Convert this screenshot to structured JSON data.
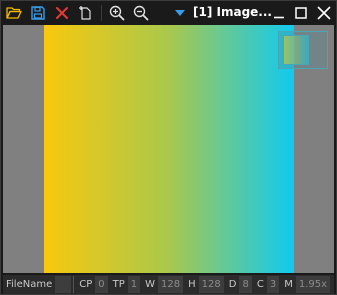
{
  "window": {
    "title": "[1] Image..."
  },
  "toolbar": {
    "open_icon": "folder-open-icon",
    "save_icon": "floppy-disk-icon",
    "close_image_icon": "red-x-icon",
    "new_icon": "new-document-plus-icon",
    "zoom_in_icon": "zoom-in-icon",
    "zoom_out_icon": "zoom-out-icon",
    "dropdown_icon": "triangle-down-icon",
    "minimize_icon": "minimize-icon",
    "maximize_icon": "maximize-icon",
    "close_icon": "close-icon"
  },
  "image": {
    "gradient_start": "#f9c80e",
    "gradient_mid": "#a9c84c",
    "gradient_end": "#0fcaf0",
    "background": "#808080"
  },
  "statusbar": {
    "filename_label": "FileName",
    "filename_value": "",
    "cp_label": "CP",
    "cp_value": "0",
    "tp_label": "TP",
    "tp_value": "1",
    "w_label": "W",
    "w_value": "128",
    "h_label": "H",
    "h_value": "128",
    "d_label": "D",
    "d_value": "8",
    "c_label": "C",
    "c_value": "3",
    "m_label": "M",
    "m_value": "1.95x"
  }
}
